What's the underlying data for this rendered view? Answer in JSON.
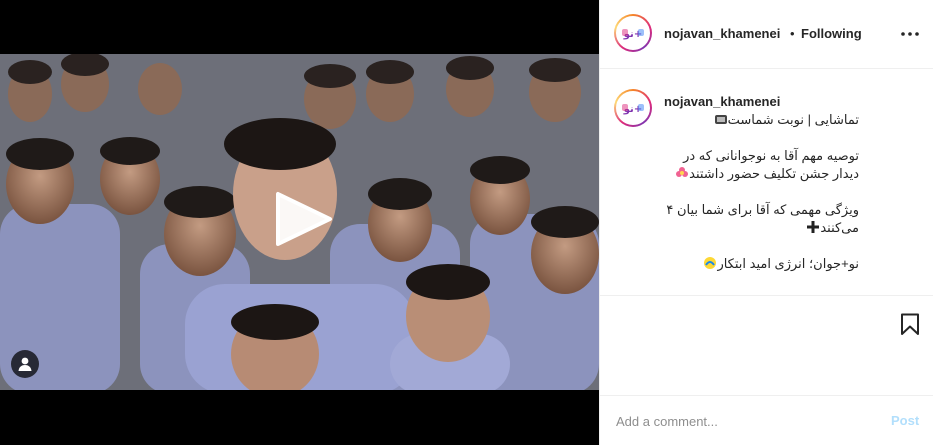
{
  "post": {
    "username": "nojavan_khamenei",
    "separator": "•",
    "follow_status": "Following",
    "caption_author": "nojavan_khamenei",
    "caption_lines": [
      "تماشایی | نوبت شماست",
      "توصیه مهم آقا به نوجوانانی که در دیدار جشن تکلیف حضور داشتند",
      "ویژگی مهمی که آقا برای شما بیان ۴ می‌کنند",
      "نو+جوان؛ انرژی امید ابتکار"
    ],
    "caption_emojis": [
      "tv-icon",
      "flower-icon",
      "plus-icon",
      "energy-icon"
    ]
  },
  "comment_box": {
    "placeholder": "Add a comment...",
    "post_label": "Post"
  },
  "colors": {
    "accent_disabled": "#b2dffc",
    "border": "#efefef",
    "text": "#262626",
    "muted": "#8e8e8e"
  }
}
